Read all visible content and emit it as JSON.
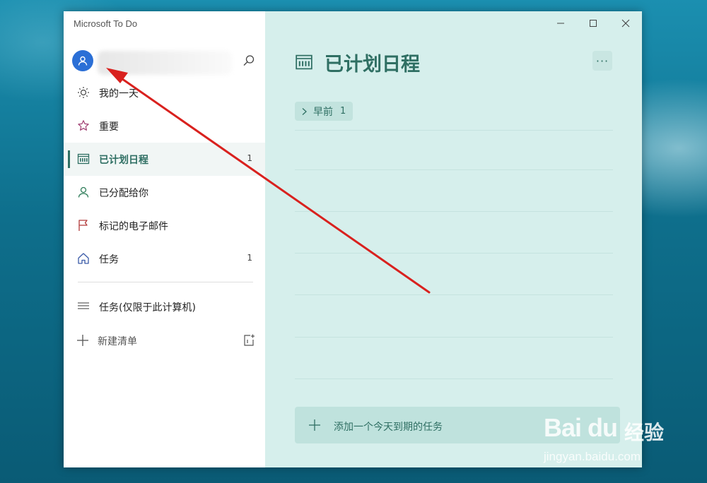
{
  "app": {
    "title": "Microsoft To Do"
  },
  "sidebar": {
    "items": [
      {
        "label": "我的一天",
        "count": "",
        "icon": "sun-icon"
      },
      {
        "label": "重要",
        "count": "",
        "icon": "star-icon"
      },
      {
        "label": "已计划日程",
        "count": "1",
        "icon": "calendar-icon",
        "active": true
      },
      {
        "label": "已分配给你",
        "count": "",
        "icon": "person-icon"
      },
      {
        "label": "标记的电子邮件",
        "count": "",
        "icon": "flag-icon"
      },
      {
        "label": "任务",
        "count": "1",
        "icon": "home-icon"
      }
    ],
    "lists": [
      {
        "label": "任务(仅限于此计算机)",
        "icon": "list-icon"
      }
    ],
    "new_list_label": "新建清单"
  },
  "main": {
    "title": "已计划日程",
    "more_label": "···",
    "group": {
      "label": "早前",
      "count": "1"
    },
    "add_task_placeholder": "添加一个今天到期的任务"
  },
  "watermark": {
    "brand": "Bai du",
    "cn": "经验",
    "url": "jingyan.baidu.com"
  },
  "colors": {
    "accent": "#2f6f63",
    "main_bg": "#d6efec",
    "arrow": "#d9211e",
    "avatar": "#2b6fd6"
  }
}
